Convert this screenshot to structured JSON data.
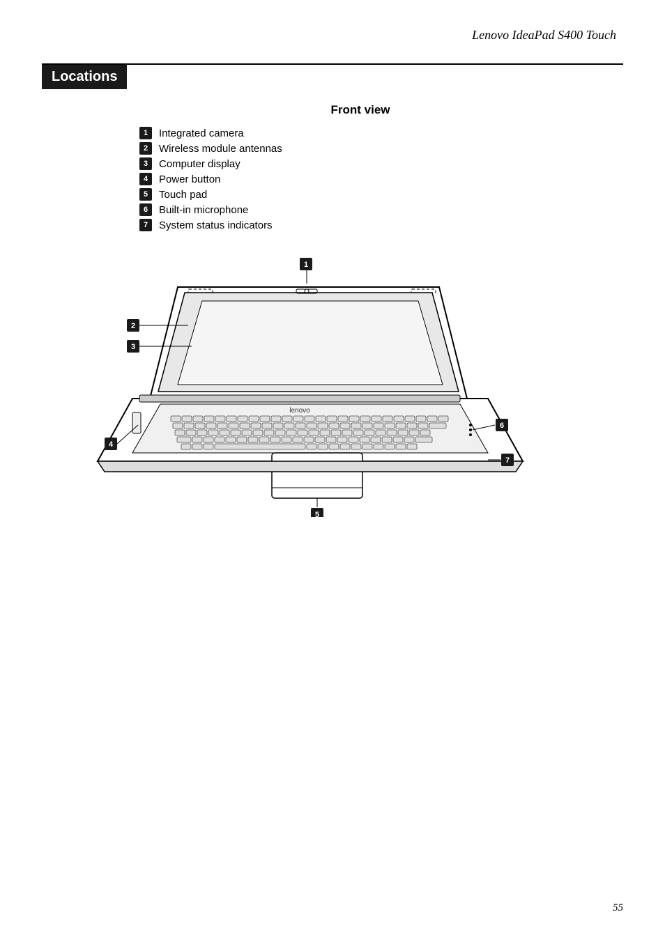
{
  "header": {
    "title": "Lenovo IdeaPad S400 Touch"
  },
  "section": {
    "label": "Locations",
    "subsection": "Front view",
    "items": [
      {
        "num": "1",
        "label": "Integrated camera"
      },
      {
        "num": "2",
        "label": "Wireless module antennas"
      },
      {
        "num": "3",
        "label": "Computer display"
      },
      {
        "num": "4",
        "label": "Power button"
      },
      {
        "num": "5",
        "label": "Touch pad"
      },
      {
        "num": "6",
        "label": "Built-in microphone"
      },
      {
        "num": "7",
        "label": "System status indicators"
      }
    ]
  },
  "page_number": "55"
}
